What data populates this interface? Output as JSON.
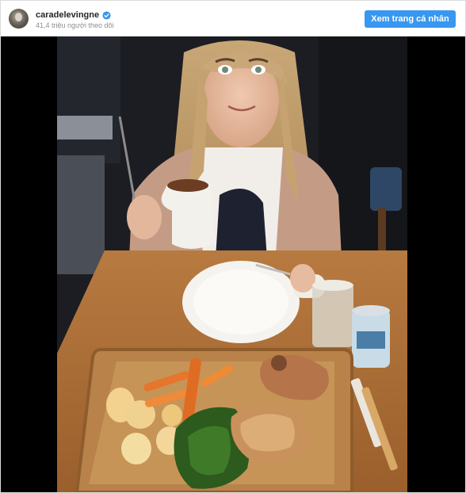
{
  "header": {
    "username": "caradelevingne",
    "followers_text": "41,4 triệu người theo dõi",
    "view_profile_label": "Xem trang cá nhân",
    "verified_icon": "verified-badge-icon"
  },
  "colors": {
    "accent": "#3897f0",
    "username": "#262626",
    "secondary_text": "#8e8e8e",
    "photo_background": "#000000"
  }
}
